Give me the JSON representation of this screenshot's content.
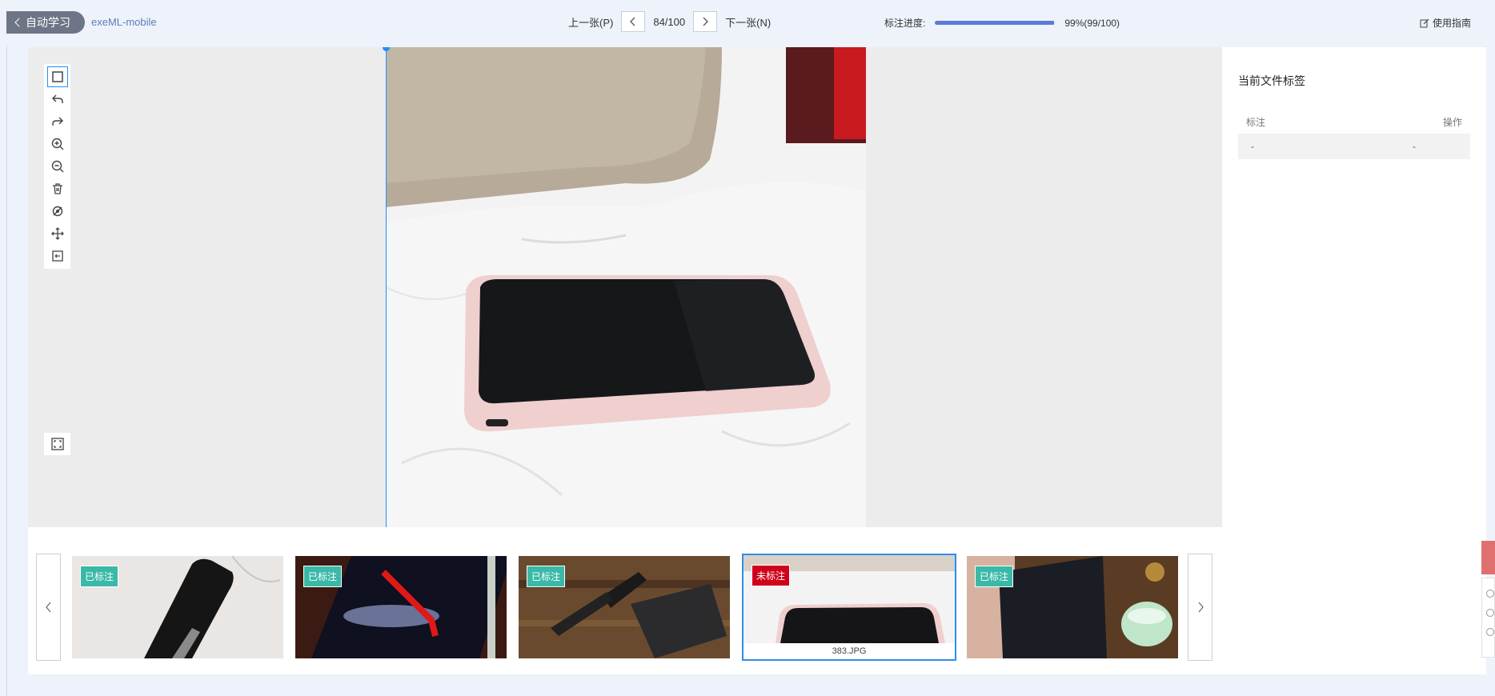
{
  "header": {
    "back_label": "自动学习",
    "project_name": "exeML-mobile",
    "prev_label": "上一张(P)",
    "page_indicator": "84/100",
    "next_label": "下一张(N)",
    "progress_label": "标注进度:",
    "progress_value": 0.99,
    "progress_text": "99%(99/100)",
    "guide_label": "使用指南"
  },
  "toolbar": {
    "tools": [
      "rectangle-icon",
      "undo-icon",
      "redo-icon",
      "zoom-in-icon",
      "zoom-out-icon",
      "delete-icon",
      "hide-icon",
      "move-icon",
      "reset-icon"
    ],
    "active_tool": "rectangle-icon",
    "fit_tool": "fit-screen-icon"
  },
  "side_panel": {
    "title": "当前文件标签",
    "col_label": "标注",
    "col_action": "操作",
    "rows": [
      {
        "label": "-",
        "action": "-"
      }
    ]
  },
  "strip": {
    "thumbnails": [
      {
        "status": "已标注",
        "status_type": "done"
      },
      {
        "status": "已标注",
        "status_type": "done"
      },
      {
        "status": "已标注",
        "status_type": "done"
      },
      {
        "status": "未标注",
        "status_type": "todo",
        "caption": "383.JPG",
        "selected": true
      },
      {
        "status": "已标注",
        "status_type": "done"
      }
    ]
  },
  "colors": {
    "accent": "#2d8ee8",
    "done_badge": "#3ab9a8",
    "todo_badge": "#d0021b",
    "progress": "#5b7bd9"
  }
}
